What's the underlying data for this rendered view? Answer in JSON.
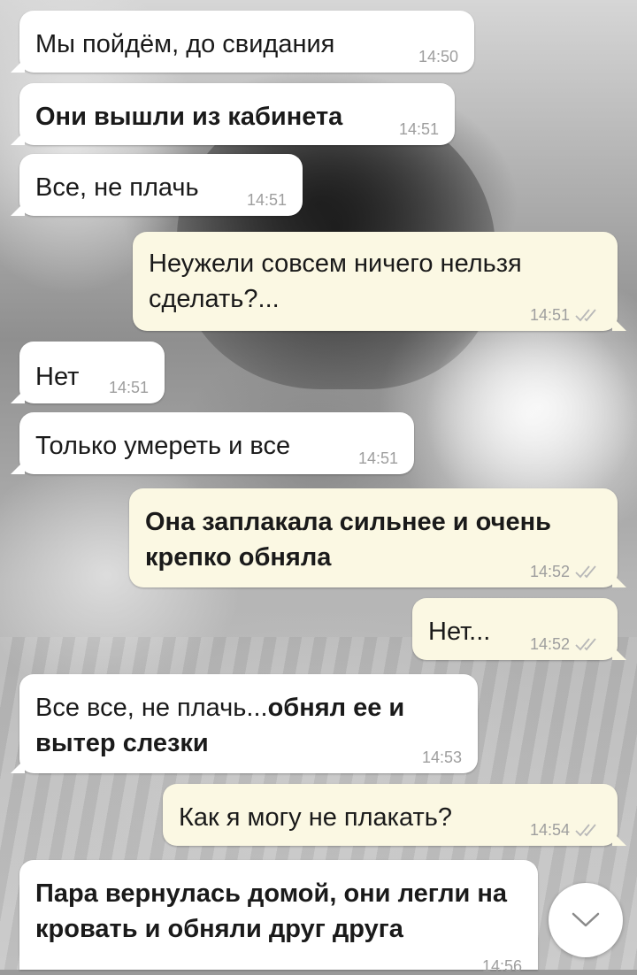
{
  "messages": [
    {
      "id": "m1",
      "direction": "in",
      "text": "Мы пойдём, до свидания",
      "time": "14:50"
    },
    {
      "id": "m2",
      "direction": "in",
      "text": "Они вышли из кабинета",
      "time": "14:51",
      "bold": true
    },
    {
      "id": "m3",
      "direction": "in",
      "text": "Все, не плачь",
      "time": "14:51"
    },
    {
      "id": "m4",
      "direction": "out",
      "text": "Неужели совсем ничего нельзя сделать?...",
      "time": "14:51",
      "status": "read"
    },
    {
      "id": "m5",
      "direction": "in",
      "text": "Нет",
      "time": "14:51"
    },
    {
      "id": "m6",
      "direction": "in",
      "text": "Только умереть и все",
      "time": "14:51"
    },
    {
      "id": "m7",
      "direction": "out",
      "text": "Она заплакала сильнее и очень крепко обняла",
      "time": "14:52",
      "status": "read",
      "bold": true
    },
    {
      "id": "m8",
      "direction": "out",
      "text": "Нет...",
      "time": "14:52",
      "status": "read"
    },
    {
      "id": "m9",
      "direction": "in",
      "text_plain": "Все все, не плачь...",
      "text_bold": "обнял ее и вытер слезки",
      "time": "14:53"
    },
    {
      "id": "m10",
      "direction": "out",
      "text": "Как я могу не плакать?",
      "time": "14:54",
      "status": "read"
    },
    {
      "id": "m11",
      "direction": "in",
      "text": "Пара вернулась домой, они легли на кровать и обняли друг друга",
      "time": "14:56",
      "bold": true
    }
  ],
  "scroll_button": {
    "icon": "chevron-down-icon"
  },
  "colors": {
    "incoming_bubble": "#ffffff",
    "outgoing_bubble": "#fbf8e3",
    "timestamp": "#9e9e9e",
    "read_check": "#b8b8b8"
  }
}
